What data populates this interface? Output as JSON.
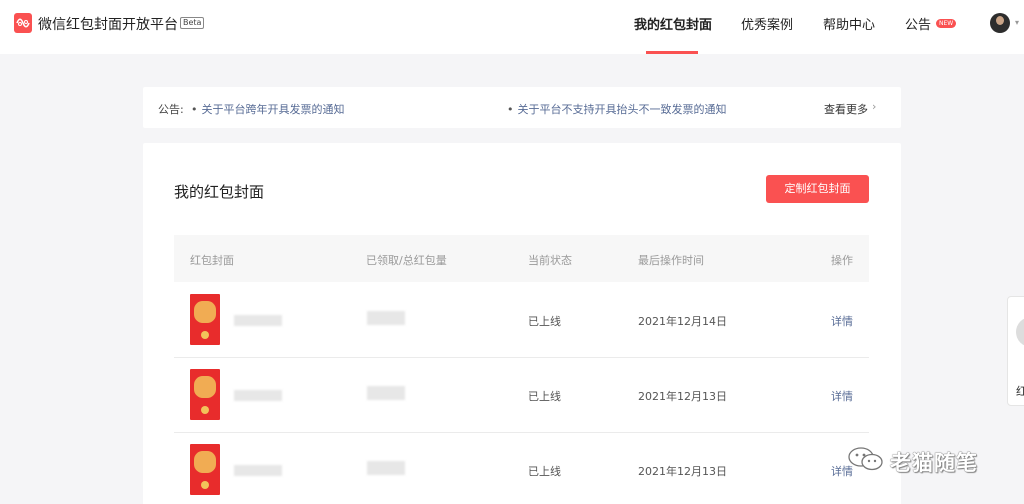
{
  "header": {
    "brand": "微信红包封面开放平台",
    "badge": "Beta",
    "nav": [
      {
        "label": "我的红包封面"
      },
      {
        "label": "优秀案例"
      },
      {
        "label": "帮助中心"
      },
      {
        "label": "公告"
      }
    ],
    "new_badge": "NEW"
  },
  "notice": {
    "label": "公告:",
    "items": [
      "关于平台跨年开具发票的通知",
      "关于平台不支持开具抬头不一致发票的通知"
    ],
    "more": "查看更多",
    "chevron": "›"
  },
  "main": {
    "title": "我的红包封面",
    "create_button": "定制红包封面",
    "columns": [
      "红包封面",
      "已领取/总红包量",
      "当前状态",
      "最后操作时间",
      "操作"
    ],
    "rows": [
      {
        "status": "已上线",
        "time": "2021年12月14日",
        "action": "详情"
      },
      {
        "status": "已上线",
        "time": "2021年12月13日",
        "action": "详情"
      },
      {
        "status": "已上线",
        "time": "2021年12月13日",
        "action": "详情"
      }
    ]
  },
  "side_widget": {
    "char": "红"
  },
  "watermark": {
    "text": "老猫随笔"
  },
  "colors": {
    "accent": "#fa5151",
    "link": "#576b95"
  }
}
